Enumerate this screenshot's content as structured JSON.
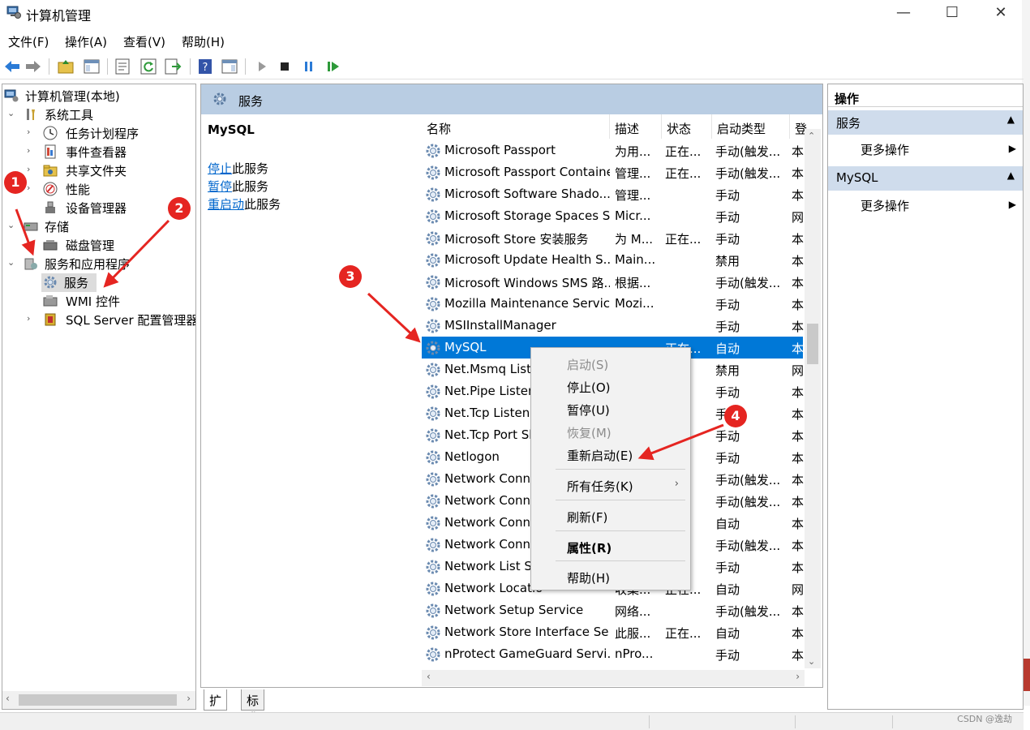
{
  "window": {
    "title": "计算机管理",
    "min": "—",
    "max": "☐",
    "close": "✕"
  },
  "menu": [
    "文件(F)",
    "操作(A)",
    "查看(V)",
    "帮助(H)"
  ],
  "tree": {
    "root": "计算机管理(本地)",
    "system_tools": "系统工具",
    "task_scheduler": "任务计划程序",
    "event_viewer": "事件查看器",
    "shared_folders": "共享文件夹",
    "performance": "性能",
    "device_manager": "设备管理器",
    "storage": "存储",
    "disk_mgmt": "磁盘管理",
    "services_apps": "服务和应用程序",
    "services": "服务",
    "wmi": "WMI 控件",
    "sql": "SQL Server 配置管理器"
  },
  "center": {
    "header": "服务",
    "selected_name": "MySQL",
    "links": [
      {
        "link": "停止",
        "rest": "此服务"
      },
      {
        "link": "暂停",
        "rest": "此服务"
      },
      {
        "link": "重启动",
        "rest": "此服务"
      }
    ],
    "columns": [
      "名称",
      "描述",
      "状态",
      "启动类型",
      "登"
    ],
    "rows": [
      {
        "name": "Microsoft Passport",
        "desc": "为用...",
        "status": "正在...",
        "start": "手动(触发...",
        "logon": "本"
      },
      {
        "name": "Microsoft Passport Container",
        "desc": "管理...",
        "status": "正在...",
        "start": "手动(触发...",
        "logon": "本"
      },
      {
        "name": "Microsoft Software Shado...",
        "desc": "管理...",
        "status": "",
        "start": "手动",
        "logon": "本"
      },
      {
        "name": "Microsoft Storage Spaces S...",
        "desc": "Micr...",
        "status": "",
        "start": "手动",
        "logon": "网"
      },
      {
        "name": "Microsoft Store 安装服务",
        "desc": "为 M...",
        "status": "正在...",
        "start": "手动",
        "logon": "本"
      },
      {
        "name": "Microsoft Update Health S...",
        "desc": "Main...",
        "status": "",
        "start": "禁用",
        "logon": "本"
      },
      {
        "name": "Microsoft Windows SMS 路...",
        "desc": "根据...",
        "status": "",
        "start": "手动(触发...",
        "logon": "本"
      },
      {
        "name": "Mozilla Maintenance Service",
        "desc": "Mozi...",
        "status": "",
        "start": "手动",
        "logon": "本"
      },
      {
        "name": "MSIInstallManager",
        "desc": "",
        "status": "",
        "start": "手动",
        "logon": "本"
      },
      {
        "name": "MySQL",
        "desc": "",
        "status": "正在...",
        "start": "自动",
        "logon": "本"
      },
      {
        "name": "Net.Msmq Liste",
        "desc": "",
        "status": "",
        "start": "禁用",
        "logon": "网"
      },
      {
        "name": "Net.Pipe Listen",
        "desc": "",
        "status": "",
        "start": "手动",
        "logon": "本"
      },
      {
        "name": "Net.Tcp Listen",
        "desc": "",
        "status": "",
        "start": "手",
        "logon": "本"
      },
      {
        "name": "Net.Tcp Port Sh",
        "desc": "",
        "status": "",
        "start": "手动",
        "logon": "本"
      },
      {
        "name": "Netlogon",
        "desc": "",
        "status": "",
        "start": "手动",
        "logon": "本"
      },
      {
        "name": "Network Conne",
        "desc": "",
        "status": "",
        "start": "手动(触发...",
        "logon": "本"
      },
      {
        "name": "Network Conne",
        "desc": "",
        "status": "正...",
        "start": "手动(触发...",
        "logon": "本"
      },
      {
        "name": "Network Conne",
        "desc": "",
        "status": "正...",
        "start": "自动",
        "logon": "本"
      },
      {
        "name": "Network Conne",
        "desc": "",
        "status": "",
        "start": "手动(触发...",
        "logon": "本"
      },
      {
        "name": "Network List Se",
        "desc": "",
        "status": "正...",
        "start": "手动",
        "logon": "本"
      },
      {
        "name": "Network Locatio",
        "desc": "收集...",
        "status": "正在...",
        "start": "自动",
        "logon": "网"
      },
      {
        "name": "Network Setup Service",
        "desc": "网络...",
        "status": "",
        "start": "手动(触发...",
        "logon": "本"
      },
      {
        "name": "Network Store Interface Se...",
        "desc": "此服...",
        "status": "正在...",
        "start": "自动",
        "logon": "本"
      },
      {
        "name": "nProtect GameGuard Servi...",
        "desc": "nPro...",
        "status": "",
        "start": "手动",
        "logon": "本"
      }
    ]
  },
  "tabs": [
    "扩展",
    "标准"
  ],
  "actions": {
    "header": "操作",
    "group1": "服务",
    "group2": "MySQL",
    "more1": "更多操作",
    "more2": "更多操作"
  },
  "context_menu": {
    "start": "启动(S)",
    "stop": "停止(O)",
    "pause": "暂停(U)",
    "resume": "恢复(M)",
    "restart": "重新启动(E)",
    "all_tasks": "所有任务(K)",
    "refresh": "刷新(F)",
    "properties": "属性(R)",
    "help": "帮助(H)"
  },
  "badges": [
    "1",
    "2",
    "3",
    "4"
  ],
  "watermark": "CSDN @逸劫",
  "colors": {
    "selection": "#0078d7",
    "header_band": "#b9cde3",
    "badge": "#e52521",
    "link": "#0066cc"
  }
}
